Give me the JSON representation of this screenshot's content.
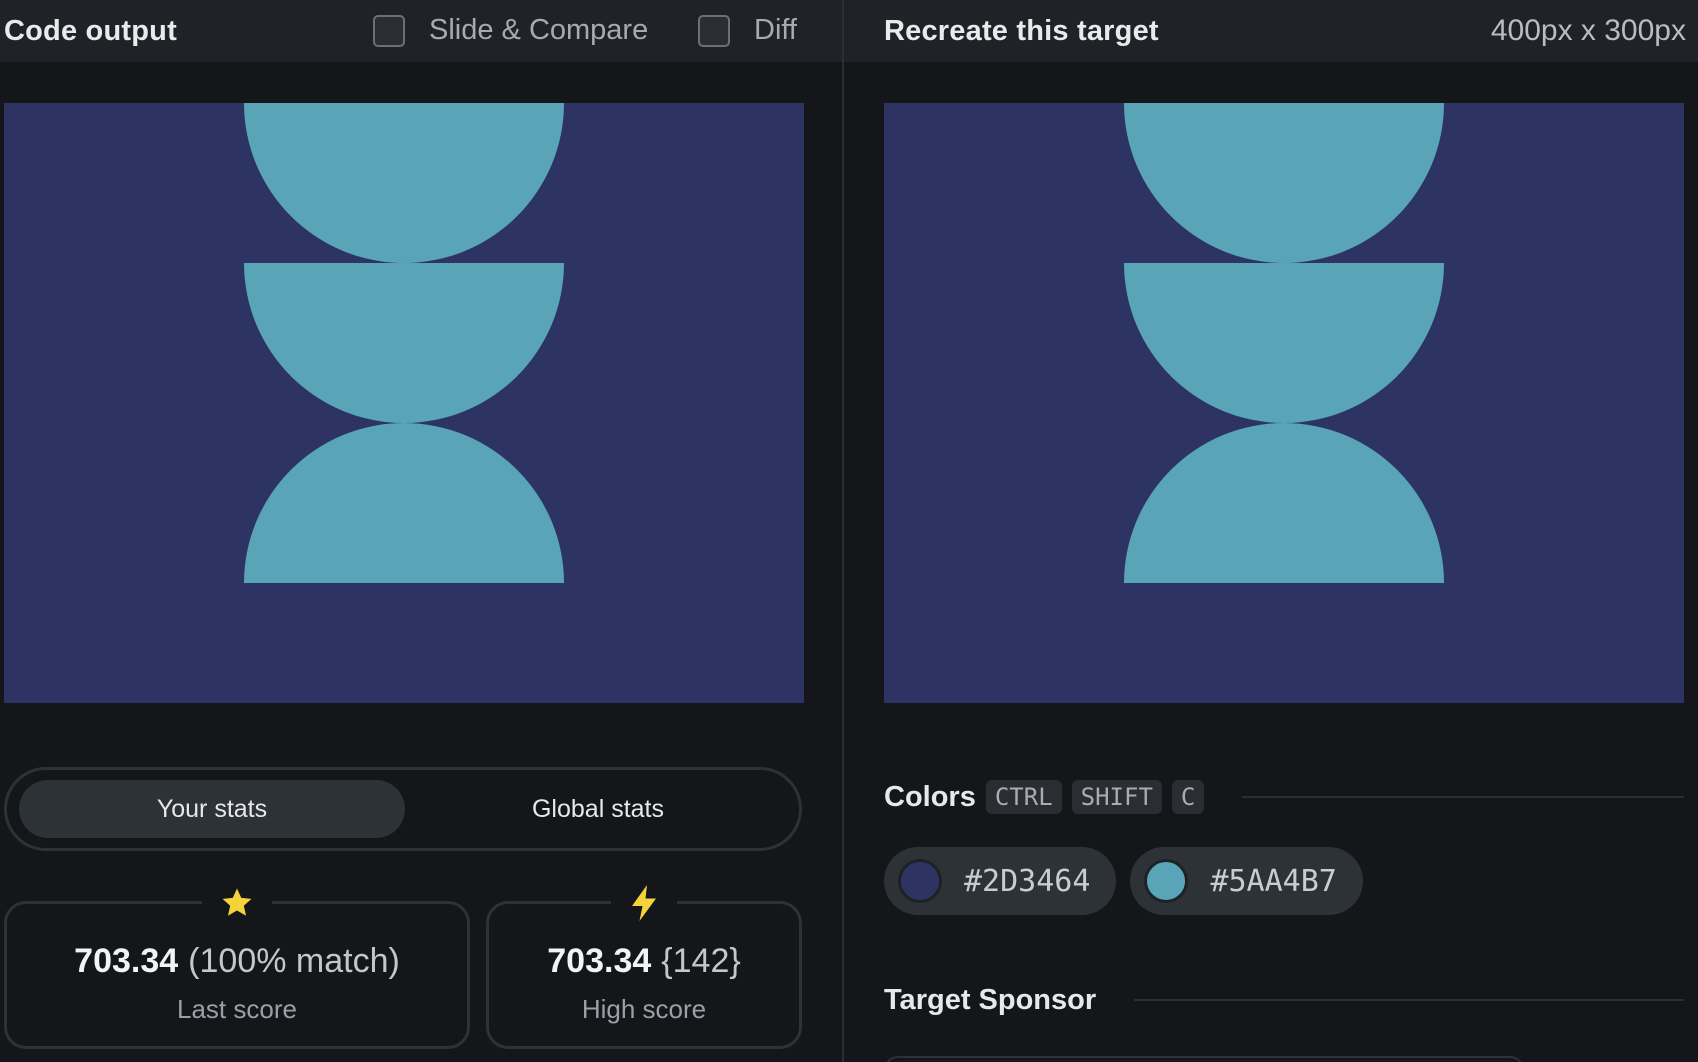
{
  "left": {
    "title": "Code output",
    "checkboxes": [
      {
        "label": "Slide & Compare",
        "checked": false
      },
      {
        "label": "Diff",
        "checked": false
      }
    ]
  },
  "right": {
    "title": "Recreate this target",
    "size_label": "400px x 300px"
  },
  "canvas": {
    "background": "#2D3464",
    "shape_color": "#5AA4B7"
  },
  "stats": {
    "tabs": [
      "Your stats",
      "Global stats"
    ],
    "active_tab": "Your stats",
    "last_score": {
      "value": "703.34",
      "extra": "(100% match)",
      "label": "Last score",
      "icon": "star-icon"
    },
    "high_score": {
      "value": "703.34",
      "extra": "{142}",
      "label": "High score",
      "icon": "lightning-icon"
    }
  },
  "colors": {
    "title": "Colors",
    "shortcut": [
      "CTRL",
      "SHIFT",
      "C"
    ],
    "swatches": [
      {
        "hex": "#2D3464"
      },
      {
        "hex": "#5AA4B7"
      }
    ]
  },
  "sponsor": {
    "title": "Target Sponsor"
  },
  "accent_colors": {
    "star": "#f5d33a",
    "lightning": "#f5d33a"
  }
}
